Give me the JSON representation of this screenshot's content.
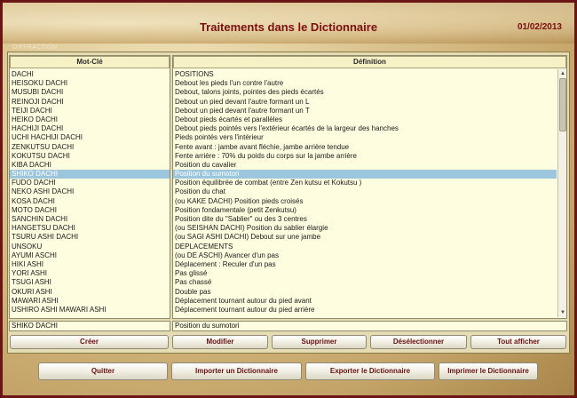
{
  "header": {
    "title": "Traitements dans le Dictionnaire",
    "date": "01/02/2013"
  },
  "tab_label": "DIFFRACTION",
  "columns": {
    "keyword": "Mot-Clé",
    "definition": "Définition"
  },
  "rows": [
    {
      "key": "DACHI",
      "def": "POSITIONS"
    },
    {
      "key": "HEISOKU DACHI",
      "def": "Debout les pieds l'un contre l'autre"
    },
    {
      "key": "MUSUBI DACHI",
      "def": "Debout, talons joints, pointes des pieds écartés"
    },
    {
      "key": "REINOJI DACHI",
      "def": "Debout un pied devant l'autre formant un L"
    },
    {
      "key": "TEIJI DACHI",
      "def": "Debout un pied devant l'autre formant un T"
    },
    {
      "key": "HEIKO DACHI",
      "def": "Debout pieds écartés et parallèles"
    },
    {
      "key": "HACHIJI DACHI",
      "def": "Debout pieds pointés vers l'extérieur écartés de la largeur des hanches"
    },
    {
      "key": "UCHI HACHIJI DACHI",
      "def": "Pieds pointés vers l'intérieur"
    },
    {
      "key": "ZENKUTSU DACHI",
      "def": "Fente avant : jambe avant fléchie, jambe arrière tendue"
    },
    {
      "key": "KOKUTSU DACHI",
      "def": "Fente arrière : 70% du poids du corps sur la jambe arrière"
    },
    {
      "key": "KIBA DACHI",
      "def": "Position du cavalier"
    },
    {
      "key": "SHIKO DACHI",
      "def": "Position du sumotori",
      "selected": true
    },
    {
      "key": "FUDO DACHI",
      "def": "Position équilibrée de combat (entre Zen kutsu et Kokutsu )"
    },
    {
      "key": "NEKO ASHI DACHI",
      "def": "Position du chat"
    },
    {
      "key": "KOSA DACHI",
      "def": "(ou KAKE DACHI) Position pieds croisés"
    },
    {
      "key": "MOTO DACHI",
      "def": "Position fondamentale (petit Zenkutsu)"
    },
    {
      "key": "SANCHIN DACHI",
      "def": "Position dite du \"Sablier\" ou des 3 centres"
    },
    {
      "key": "HANGETSU DACHI",
      "def": "(ou SEISHAN DACHI) Position du sablier élargie"
    },
    {
      "key": "TSURU ASHI DACHI",
      "def": "(ou SAGI ASHI DACHI) Debout sur une jambe"
    },
    {
      "key": "UNSOKU",
      "def": "DEPLACEMENTS"
    },
    {
      "key": "AYUMI ASCHI",
      "def": "(ou DE ASCHI) Avancer d'un pas"
    },
    {
      "key": "HIKI ASHI",
      "def": "Déplacement : Reculer d'un pas"
    },
    {
      "key": "YORI ASHI",
      "def": "Pas glissé"
    },
    {
      "key": "TSUGI ASHI",
      "def": "Pas chassé"
    },
    {
      "key": "OKURI ASHI",
      "def": "Double pas"
    },
    {
      "key": "MAWARI ASHI",
      "def": "Déplacement tournant autour du pied avant"
    },
    {
      "key": "USHIRO ASHI MAWARI ASHI",
      "def": "Déplacement tournant autour du pied arrière"
    }
  ],
  "scrollbar": {
    "up": "▲",
    "down": "▼"
  },
  "edit": {
    "keyword_value": "SHIKO DACHI",
    "definition_value": "Position du sumotori"
  },
  "buttons": {
    "create": "Créer",
    "modify": "Modifier",
    "delete": "Supprimer",
    "deselect": "Désélectionner",
    "show_all": "Tout afficher",
    "quit": "Quitter",
    "import": "Importer un Dictionnaire",
    "export": "Exporter le Dictionnaire",
    "print": "Imprimer le Dictionnaire"
  },
  "colors": {
    "brand": "#7a1010",
    "frame": "#6b1515",
    "selection": "#9bc6de"
  }
}
